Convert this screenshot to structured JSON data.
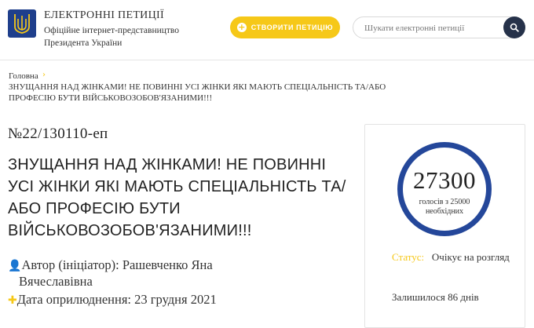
{
  "header": {
    "title": "ЕЛЕКТРОННІ ПЕТИЦІЇ",
    "subtitle": "Офіційне інтернет-представництво Президента України",
    "create_button": "СТВОРИТИ ПЕТИЦІЮ",
    "search_placeholder": "Шукати електронні петиції",
    "logo_icon": "trident-icon",
    "search_icon": "search-icon"
  },
  "breadcrumb": {
    "home": "Головна",
    "current": "ЗНУЩАННЯ НАД ЖІНКАМИ! НЕ ПОВИННІ УСІ ЖІНКИ ЯКІ МАЮТЬ СПЕЦІАЛЬНІСТЬ ТА/АБО ПРОФЕСІЮ БУТИ ВІЙСЬКОВОЗОБОВ'ЯЗАНИМИ!!!"
  },
  "petition": {
    "number": "№22/130110-еп",
    "title": "ЗНУЩАННЯ НАД ЖІНКАМИ! НЕ ПОВИННІ УСІ ЖІНКИ ЯКІ МАЮТЬ СПЕЦІАЛЬНІСТЬ ТА/АБО ПРОФЕСІЮ БУТИ ВІЙСЬКОВОЗОБОВ'ЯЗАНИМИ!!!",
    "author_label": "Автор (ініціатор): ",
    "author_name_1": "Рашевченко Яна",
    "author_name_2": "Вячеславівна",
    "date_label": "Дата оприлюднення: ",
    "date_value": "23 грудня 2021"
  },
  "panel": {
    "votes": "27300",
    "votes_sub": "голосів з 25000 необхідних",
    "status_label": "Статус:",
    "status_value": "Очікує на розгляд",
    "remaining": "Залишилося 86 днів"
  },
  "colors": {
    "accent": "#f6c818",
    "circle": "#24479a",
    "search_button": "#26324a"
  }
}
